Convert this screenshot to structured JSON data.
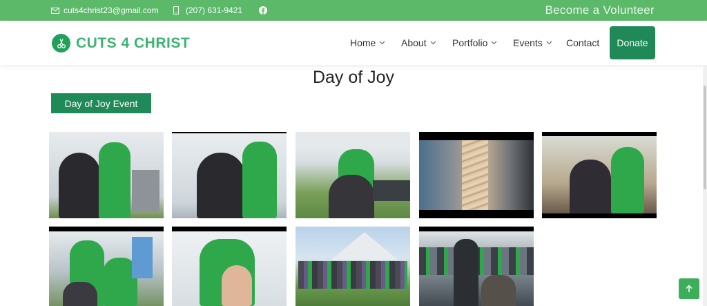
{
  "topbar": {
    "email": "cuts4christ23@gmail.com",
    "phone": "(207) 631-9421",
    "volunteer": "Become a Volunteer"
  },
  "brand": {
    "name": "CUTS 4 CHRIST"
  },
  "nav": {
    "home": "Home",
    "about": "About",
    "portfolio": "Portfolio",
    "events": "Events",
    "contact": "Contact",
    "donate": "Donate"
  },
  "page": {
    "title": "Day of Joy",
    "event_button": "Day of Joy Event"
  },
  "colors": {
    "topbar": "#5cb96a",
    "brand": "#3cb371",
    "button": "#1f8a58",
    "shirt": "#2ea84a"
  },
  "icons": {
    "email": "envelope-icon",
    "phone": "mobile-phone-icon",
    "social": "facebook-icon",
    "logo": "scissors-icon",
    "dropdown": "chevron-down-icon",
    "scroll_top": "arrow-up-icon"
  }
}
